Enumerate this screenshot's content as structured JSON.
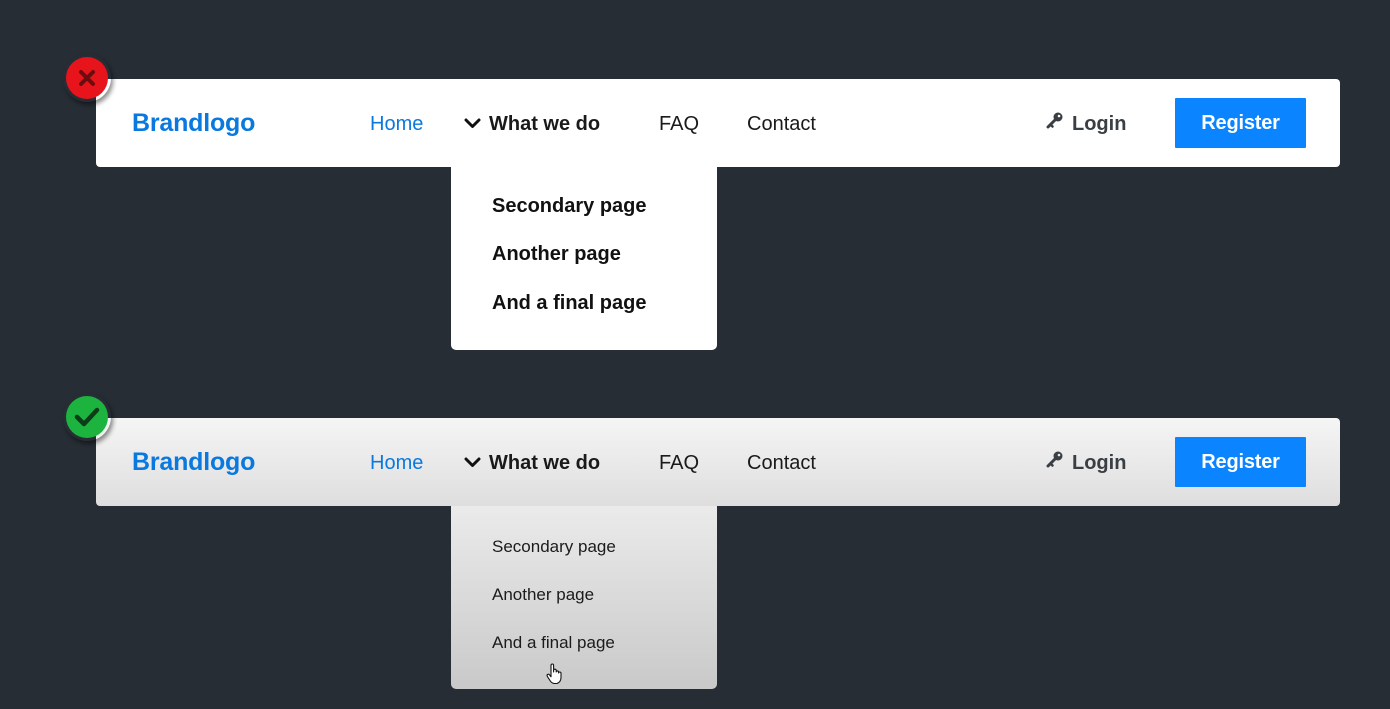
{
  "colors": {
    "background": "#272d35",
    "brand": "#0a79df",
    "home_link": "#0a79df",
    "register_button": "#0a84ff",
    "bad_badge": "#e8141b",
    "good_badge": "#1db33f"
  },
  "examples": [
    {
      "verdict_icon": "x-mark-icon",
      "nav": {
        "brand": "Brandlogo",
        "links": [
          "Home",
          "What we do",
          "FAQ",
          "Contact"
        ],
        "login": "Login",
        "register": "Register"
      },
      "dropdown": {
        "items": [
          "Secondary page",
          "Another page",
          "And a final page"
        ]
      }
    },
    {
      "verdict_icon": "check-mark-icon",
      "nav": {
        "brand": "Brandlogo",
        "links": [
          "Home",
          "What we do",
          "FAQ",
          "Contact"
        ],
        "login": "Login",
        "register": "Register"
      },
      "dropdown": {
        "items": [
          "Secondary page",
          "Another page",
          "And a final page"
        ]
      }
    }
  ]
}
